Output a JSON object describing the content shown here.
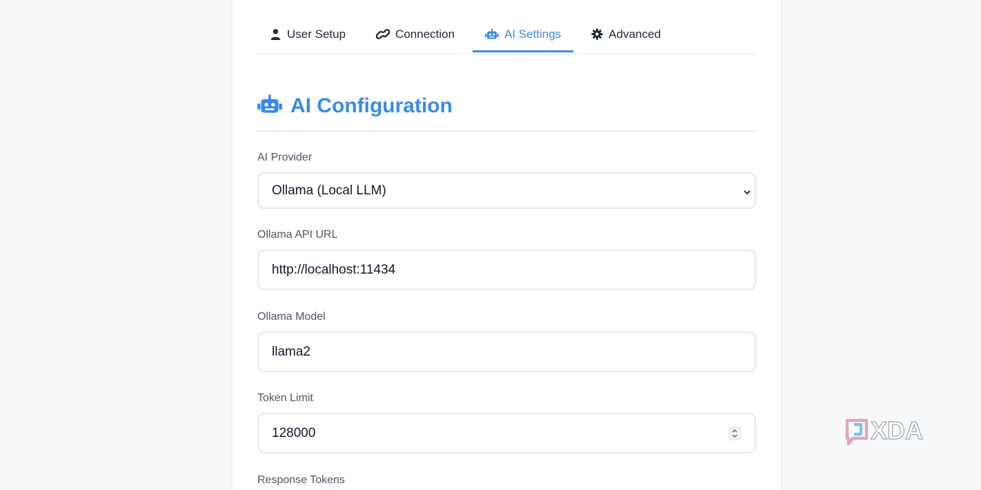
{
  "tabs": [
    {
      "label": "User Setup",
      "icon": "user-icon",
      "active": false
    },
    {
      "label": "Connection",
      "icon": "link-icon",
      "active": false
    },
    {
      "label": "AI Settings",
      "icon": "robot-icon",
      "active": true
    },
    {
      "label": "Advanced",
      "icon": "gear-icon",
      "active": false
    }
  ],
  "section": {
    "title": "AI Configuration",
    "icon": "robot-icon"
  },
  "fields": {
    "provider": {
      "label": "AI Provider",
      "value": "Ollama (Local LLM)"
    },
    "api_url": {
      "label": "Ollama API URL",
      "value": "http://localhost:11434"
    },
    "model": {
      "label": "Ollama Model",
      "value": "llama2"
    },
    "token_limit": {
      "label": "Token Limit",
      "value": "128000"
    },
    "response_tokens": {
      "label": "Response Tokens"
    }
  },
  "watermark": {
    "text": "XDA"
  },
  "colors": {
    "accent": "#3b8ae6",
    "text": "#1f2937",
    "border": "#e5e7eb"
  }
}
